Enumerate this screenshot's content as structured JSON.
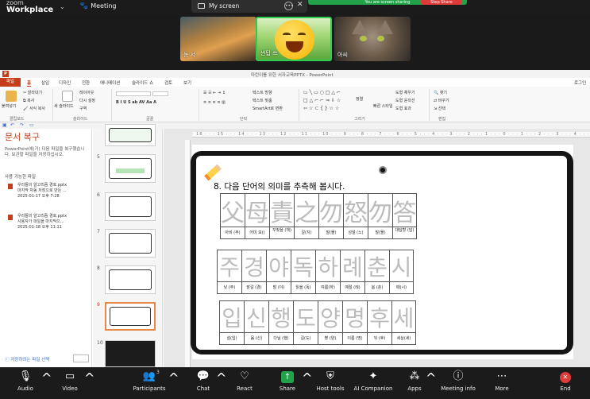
{
  "zoom": {
    "logo_line1": "zoom",
    "logo_line2": "Workplace",
    "meeting_label": "Meeting",
    "share_pill_label": "My screen",
    "share_status": "You are screen sharing",
    "stop_share_label": "Stop Share",
    "participant_names": [
      "동 서",
      "썬탑 쓰",
      "아씨"
    ],
    "toolbar": {
      "audio": "Audio",
      "video": "Video",
      "participants": "Participants",
      "participants_count": "3",
      "chat": "Chat",
      "react": "React",
      "share": "Share",
      "host_tools": "Host tools",
      "ai_companion": "AI Companion",
      "apps": "Apps",
      "meeting_info": "Meeting info",
      "more": "More",
      "end": "End"
    },
    "colors": {
      "share_green": "#22a34a",
      "end_red": "#e03b3b"
    }
  },
  "ppt": {
    "title": "마린이를 위한 서자교육PPTX - PowerPoint",
    "menu": [
      "파일",
      "홈",
      "삽입",
      "디자인",
      "전환",
      "애니메이션",
      "슬라이드 쇼",
      "검토",
      "보기"
    ],
    "signin": "로그인",
    "ribbon": {
      "paste": "붙여넣기",
      "cut": "잘라내기",
      "copy": "복사",
      "format_painter": "서식 복사",
      "new_slide": "새 슬라이드",
      "layout": "레이아웃",
      "reset": "다시 설정",
      "section": "구역",
      "text_direction": "텍스트 방향",
      "align_text": "텍스트 맞춤",
      "smartart": "SmartArt로 변환",
      "arrange": "정렬",
      "quick_styles": "빠른 스타일",
      "shape_fill": "도형 채우기",
      "shape_outline": "도형 윤곽선",
      "shape_effects": "도형 효과",
      "find": "찾기",
      "replace": "바꾸기",
      "select": "선택",
      "groups": [
        "클립보드",
        "슬라이드",
        "글꼴",
        "단락",
        "그리기",
        "편집"
      ]
    },
    "recovery": {
      "heading": "문서 복구",
      "description": "PowerPoint에(가) 다음 파일을 복구했습니다. 보관할 파일을 저장하십시오.",
      "available": "사용 가능한 파일",
      "files": [
        {
          "line1": "우리들의 알고리즘 경호.pptx",
          "line2": "마지막 자동 저장으로 만든 ...",
          "line3": "2025-01-17 오후 7:28"
        },
        {
          "line1": "우리들의 알고리즘 경호.pptx",
          "line2": "사용자가 파일을 마지막으...",
          "line3": "2025-01-18 오후 11:11"
        }
      ],
      "which_file": "저장하려는 파일 선택"
    },
    "thumb_numbers": [
      "5",
      "6",
      "7",
      "8",
      "9",
      "10"
    ],
    "ruler": "· 16 · · · 15 · · · 14 · · · 13 · · · 12 · · · 11 · · · 10 · · · 9 · · · 8 · · · 7 · · · 6 · · · 5 · · · 4 · · · 3 · · · 2 · · · 1 · · · 0 · · · 1 · · · 2 · · · 3 · · · 4 · · · 5 · · · 6 · · · 7 · · · 8 · · · 9 · · · 10 · · · 11 · · · 12 · · · 13 · · · 14 · · · 15 · · · 16 ·",
    "accent": "#c43e1c"
  },
  "slide": {
    "question": "8. 다음 단어의 의미를 추측해 봅시다.",
    "row1": {
      "chars": [
        "父",
        "母",
        "責",
        "之",
        "勿",
        "怒",
        "勿",
        "答"
      ],
      "meanings": [
        "아비 (부)",
        "어미 모()",
        "꾸짖을 (책)",
        "갈(지)",
        "말(물)",
        "성낼 (노)",
        "말(물)",
        "대답할 (답)"
      ]
    },
    "row2": {
      "chars": [
        "주",
        "경",
        "야",
        "독",
        "하",
        "례",
        "춘",
        "시"
      ],
      "meanings": [
        "낮 (주)",
        "밭갈 (경)",
        "밤 (야)",
        "읽을 (독)",
        "여름(하)",
        "예절 (례)",
        "봄 (춘)",
        "때(시)"
      ]
    },
    "row3": {
      "chars": [
        "입",
        "신",
        "행",
        "도",
        "양",
        "명",
        "후",
        "세"
      ],
      "meanings": [
        "설(입)",
        "몸 (신)",
        "다닐 (행)",
        "길(도)",
        "볕 (양)",
        "이름 (명)",
        "뒤 (후)",
        "세상(세)"
      ]
    }
  }
}
